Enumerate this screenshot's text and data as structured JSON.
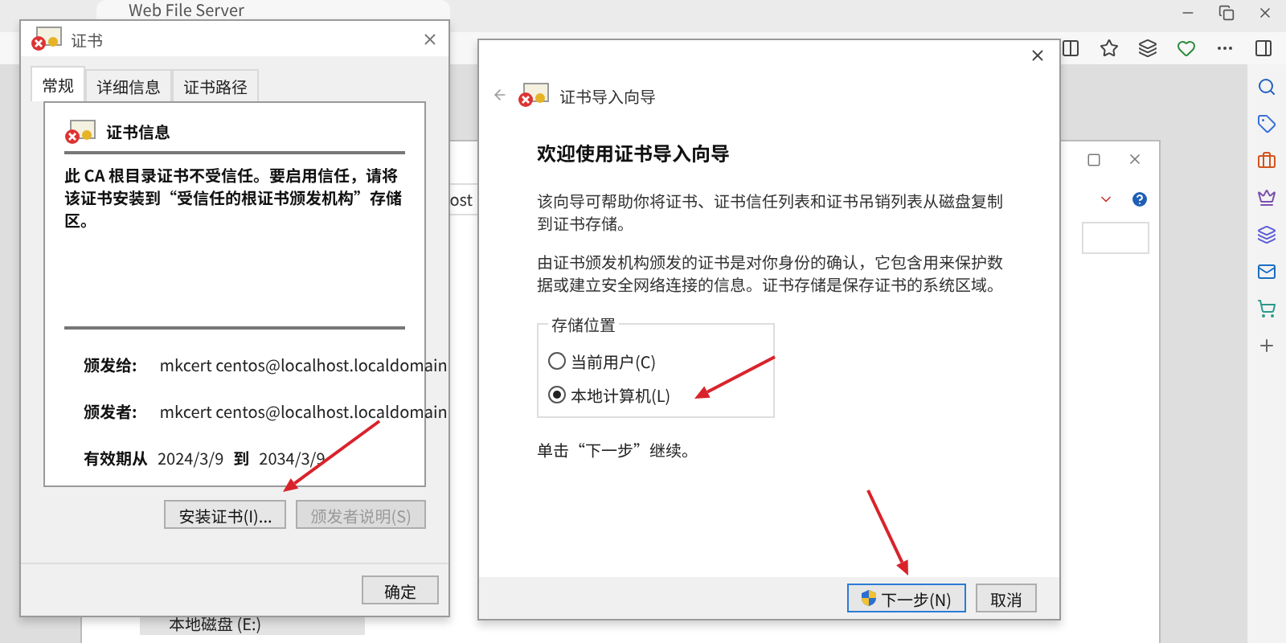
{
  "browser": {
    "tab_title": "Web File Server",
    "page_fragment": "ost"
  },
  "explorer": {
    "drives": [
      {
        "label": "本地磁盘 (E:)",
        "selected": true
      }
    ]
  },
  "cert_dialog": {
    "title": "证书",
    "tabs": [
      {
        "label": "常规",
        "selected": true
      },
      {
        "label": "详细信息",
        "selected": false
      },
      {
        "label": "证书路径",
        "selected": false
      }
    ],
    "info_heading": "证书信息",
    "warning": "此 CA 根目录证书不受信任。要启用信任，请将该证书安装到“受信任的根证书颁发机构”存储区。",
    "fields": [
      {
        "label": "颁发给:",
        "value": "mkcert centos@localhost.localdomain"
      },
      {
        "label": "颁发者:",
        "value": "mkcert centos@localhost.localdomain"
      }
    ],
    "validity": {
      "label": "有效期从",
      "from": "2024/3/9",
      "to_label": "到",
      "to": "2034/3/9"
    },
    "buttons": [
      {
        "label": "安装证书(I)...",
        "disabled": false
      },
      {
        "label": "颁发者说明(S)",
        "disabled": true
      }
    ],
    "ok_button": "确定"
  },
  "wizard": {
    "title": "证书导入向导",
    "heading": "欢迎使用证书导入向导",
    "paragraphs": [
      "该向导可帮助你将证书、证书信任列表和证书吊销列表从磁盘复制到证书存储。",
      "由证书颁发机构颁发的证书是对你身份的确认，它包含用来保护数据或建立安全网络连接的信息。证书存储是保存证书的系统区域。"
    ],
    "store_group": {
      "legend": "存储位置",
      "options": [
        {
          "label": "当前用户(C)",
          "selected": false
        },
        {
          "label": "本地计算机(L)",
          "selected": true
        }
      ]
    },
    "hint": "单击“下一步”继续。",
    "buttons": [
      {
        "label": "下一步(N)",
        "kind": "primary"
      },
      {
        "label": "取消",
        "kind": "normal"
      }
    ]
  }
}
